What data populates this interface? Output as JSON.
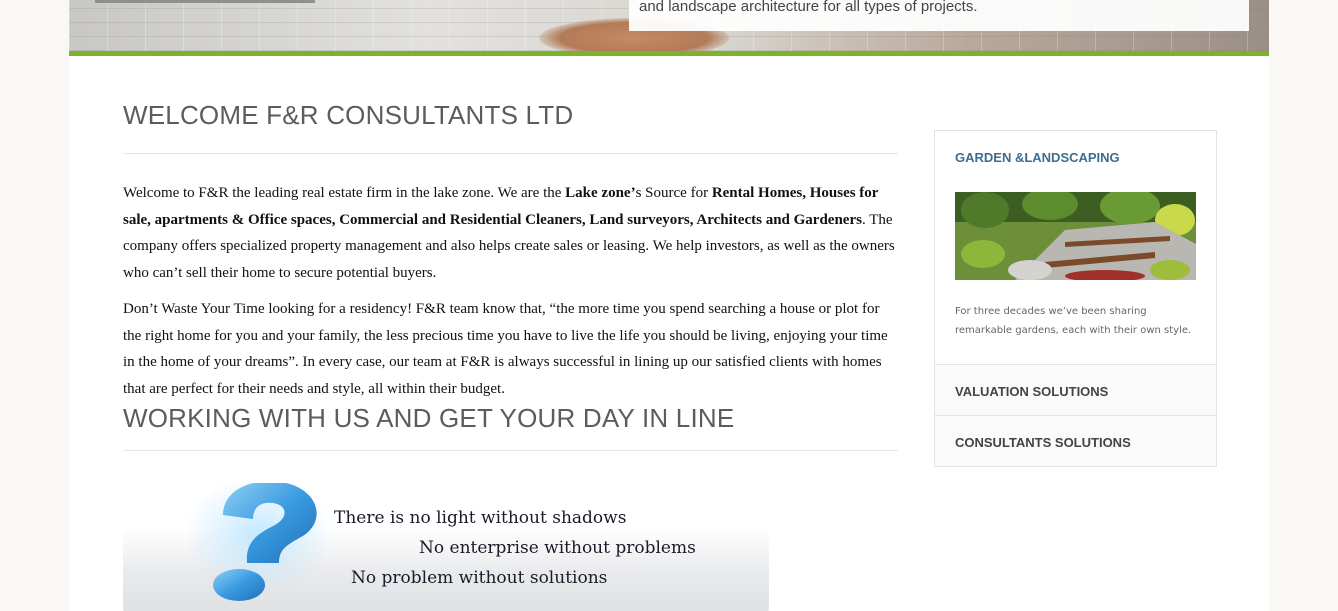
{
  "hero": {
    "caption": "and landscape architecture for all types of projects."
  },
  "main": {
    "title": "WELCOME F&R CONSULTANTS LTD",
    "para1": {
      "t1": "Welcome to F&R the leading real estate firm in the lake zone. We are the ",
      "b1": "Lake zone’",
      "t2": "s Source for ",
      "b2": "Rental Homes, Houses for sale, apartments & Office spaces, Commercial and Residential Cleaners, Land surveyors, Architects and Gardeners",
      "t3": ". The company offers specialized property management and also helps create sales or leasing. We help investors, as well as the owners who can’t sell their home to secure potential buyers."
    },
    "para2": "Don’t Waste Your Time looking for a residency! F&R team know that, “the more time you spend searching a house or plot for the right home for you and your family, the less precious time you have to live the life you should be living, enjoying your time in the home of your dreams”. In every case, our team at F&R is always successful in lining up our satisfied clients with homes that are perfect for their needs and style, all within their budget.",
    "title2": "WORKING WITH US AND GET YOUR DAY IN LINE",
    "banner": {
      "line1": "There is no light without shadows",
      "line2": "No enterprise without problems",
      "line3": "No problem without solutions"
    }
  },
  "sidebar": {
    "title": "GARDEN &LANDSCAPING",
    "text": "For three decades we’ve been sharing remarkable gardens, each with their own style.",
    "items": [
      {
        "label": "VALUATION SOLUTIONS"
      },
      {
        "label": "CONSULTANTS SOLUTIONS"
      }
    ]
  },
  "colors": {
    "accent_green": "#7cb32a",
    "sidebar_title": "#3e6d8e"
  }
}
